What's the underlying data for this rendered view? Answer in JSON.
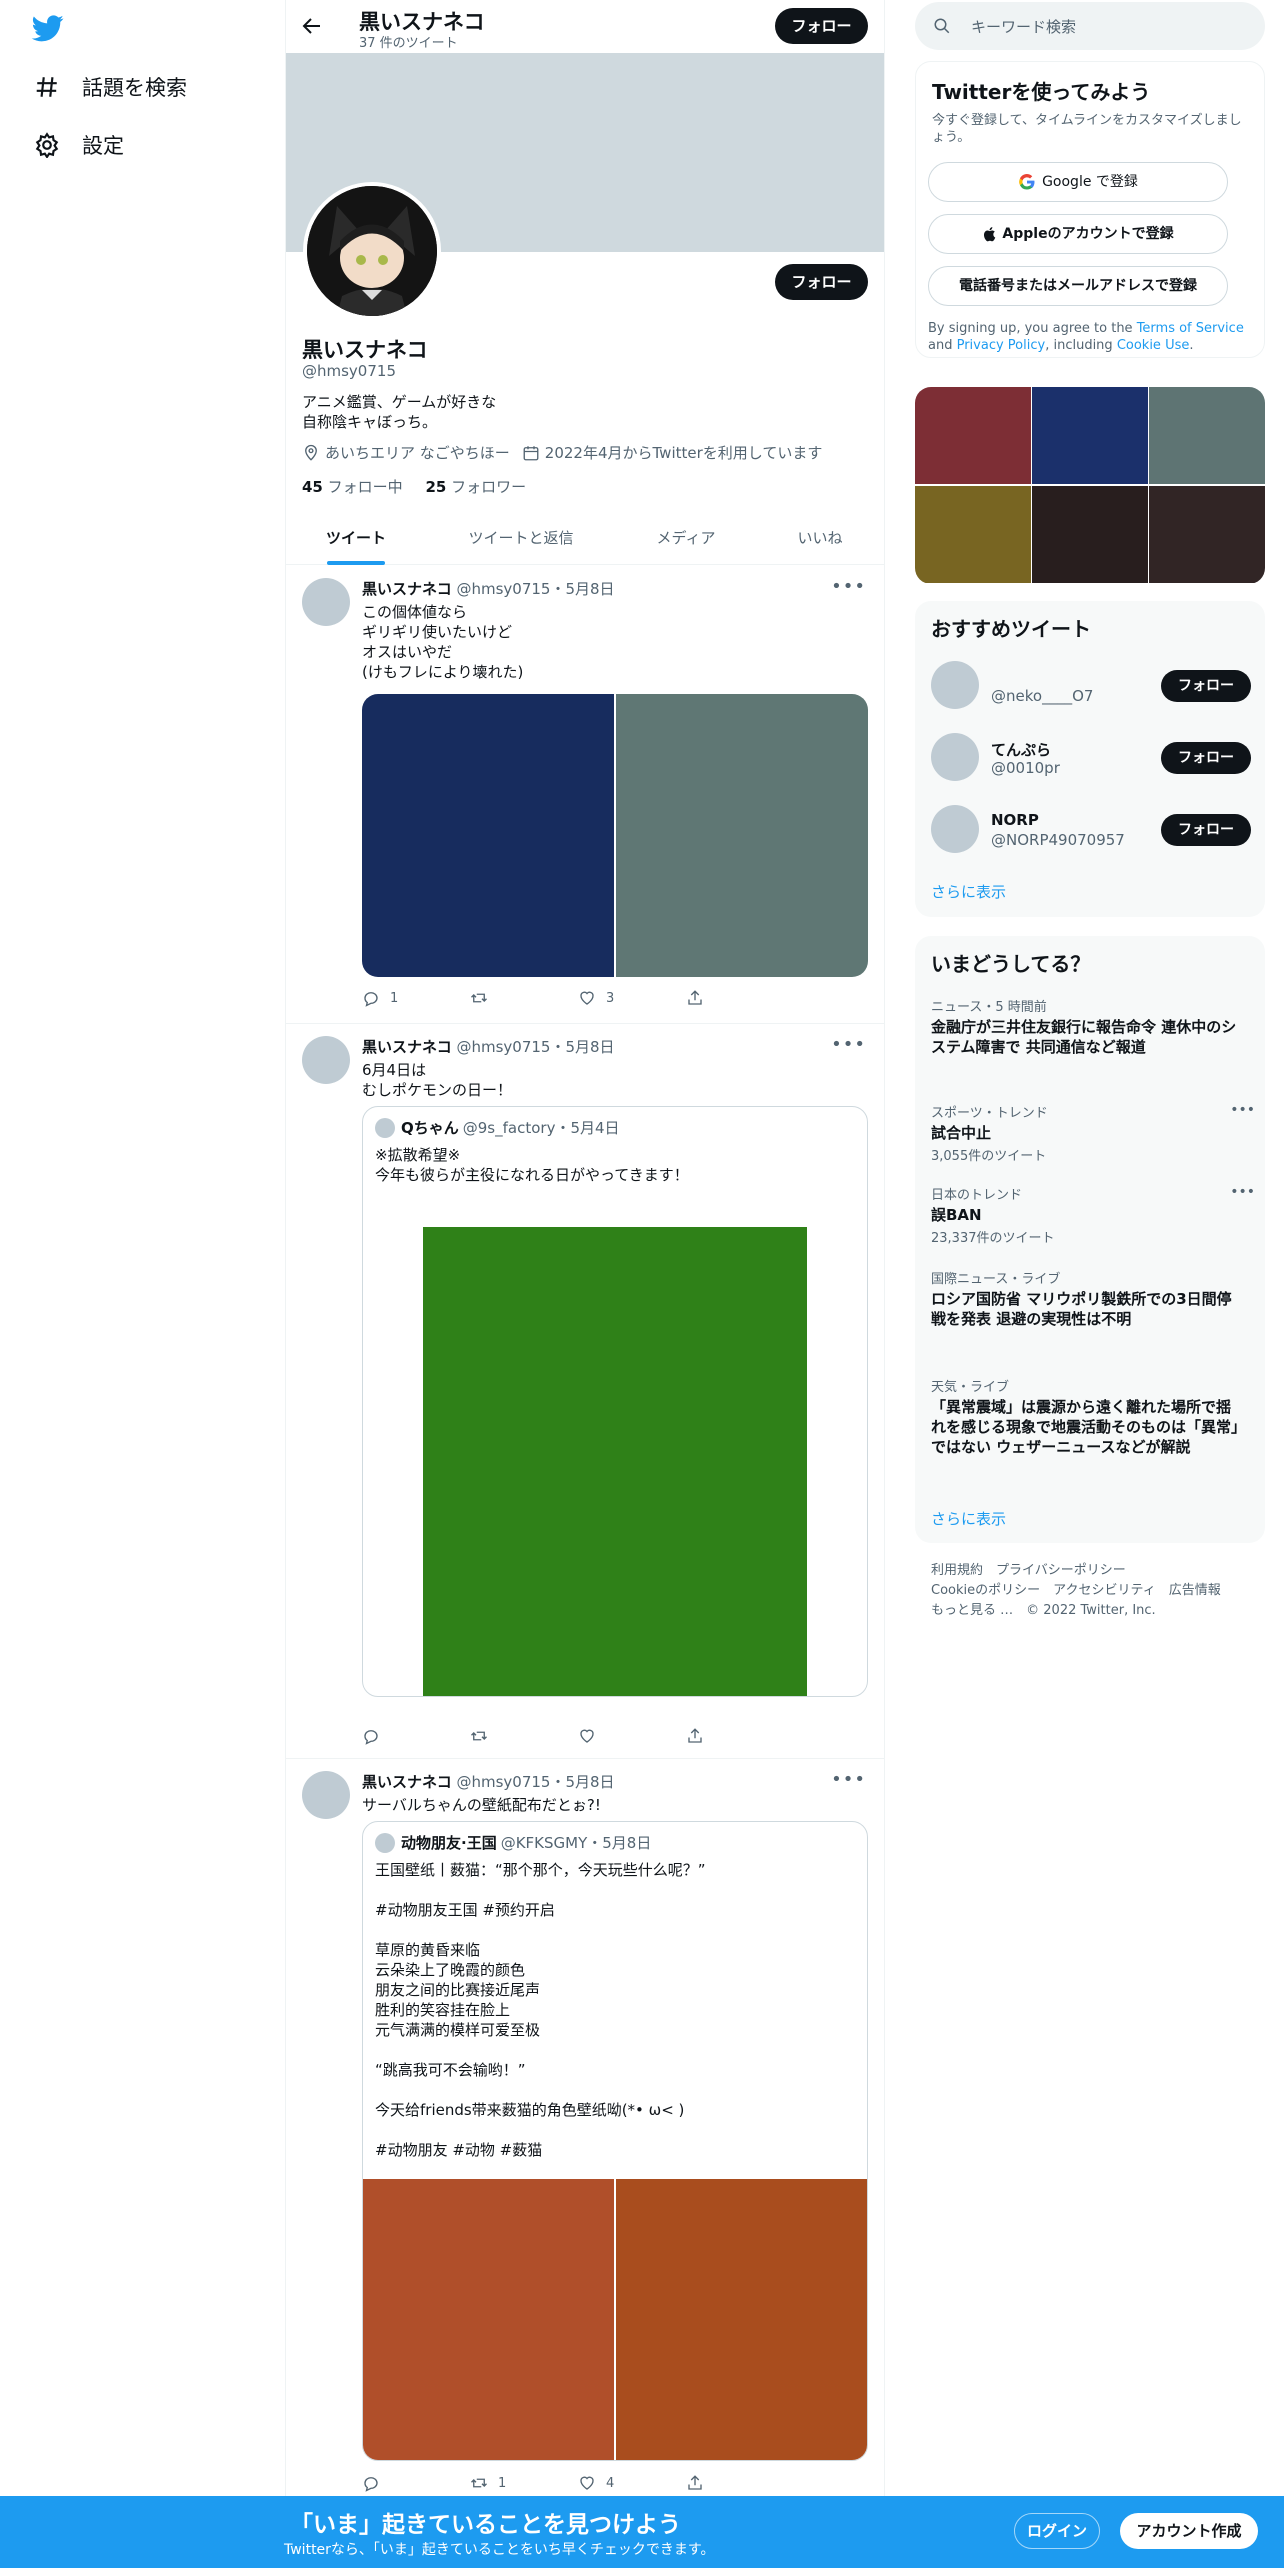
{
  "nav": {
    "explore_label": "話題を検索",
    "settings_label": "設定"
  },
  "header": {
    "name": "黒いスナネコ",
    "tweet_count": "37 件のツイート",
    "follow_label": "フォロー"
  },
  "profile": {
    "follow_label": "フォロー",
    "name": "黒いスナネコ",
    "handle": "@hmsy0715",
    "bio_line1": "アニメ鑑賞、ゲームが好きな",
    "bio_line2": "自称陰キャぼっち。",
    "location": "あいちエリア なごやちほー",
    "joined": "2022年4月からTwitterを利用しています",
    "following_count": "45",
    "following_label": "フォロー中",
    "followers_count": "25",
    "followers_label": "フォロワー"
  },
  "tabs": [
    "ツイート",
    "ツイートと返信",
    "メディア",
    "いいね"
  ],
  "tweets": [
    {
      "name": "黒いスナネコ",
      "meta": "@hmsy0715・5月8日",
      "text": "この個体値なら\nギリギリ使いたいけど\nオスはいやだ\n(けもフレにより壊れた)",
      "replies": "1",
      "retweets": "",
      "likes": "3",
      "media_colors": [
        "#172c5e",
        "#5f7774"
      ]
    },
    {
      "name": "黒いスナネコ",
      "meta": "@hmsy0715・5月8日",
      "text": "6月4日は\nむしポケモンの日ー！",
      "replies": "",
      "retweets": "",
      "likes": "",
      "quote": {
        "name": "Qちゃん",
        "meta": "@9s_factory・5月4日",
        "text": "※拡散希望※\n今年も彼らが主役になれる日がやってきます！",
        "media_color": "#2f8118"
      }
    },
    {
      "name": "黒いスナネコ",
      "meta": "@hmsy0715・5月8日",
      "text": "サーバルちゃんの壁紙配布だとぉ?!",
      "replies": "",
      "retweets": "1",
      "likes": "4",
      "quote": {
        "name": "动物朋友·王国",
        "meta": "@KFKSGMY・5月8日",
        "text": "王国壁纸丨薮猫：“那个那个，今天玩些什么呢？”\n\n#动物朋友王国 #预约开启\n\n草原的黄昏来临\n云朵染上了晚霞的颜色\n朋友之间的比赛接近尾声\n胜利的笑容挂在脸上\n元气满满的模样可爱至极\n\n“跳高我可不会输哟！”\n\n今天给friends带来薮猫的角色壁纸呦(*• ω< )\n\n#动物朋友 #动物 #薮猫",
        "media_colors": [
          "#b04f2a",
          "#a94d1e"
        ]
      }
    }
  ],
  "right": {
    "search_placeholder": "キーワード検索",
    "signup_title": "Twitterを使ってみよう",
    "signup_sub": "今すぐ登録して、タイムラインをカスタマイズしましょう。",
    "google_label": "Google で登録",
    "apple_label": "Appleのアカウントで登録",
    "phone_label": "電話番号またはメールアドレスで登録",
    "legal_a": "By signing up, you agree to the ",
    "legal_tos": "Terms of Service",
    "legal_b": " and ",
    "legal_privacy": "Privacy Policy",
    "legal_c": ", including ",
    "legal_cookie": "Cookie Use",
    "legal_d": ".",
    "media_grid_colors": [
      "#7d2e35",
      "#1b306b",
      "#5e7473",
      "#786522",
      "#281e1e",
      "#312525"
    ],
    "rec_title": "おすすめツイート",
    "recs": [
      {
        "name": "",
        "handle": "@neko____O7",
        "button": "フォロー"
      },
      {
        "name": "てんぷら",
        "handle": "@0010pr",
        "button": "フォロー"
      },
      {
        "name": "NORP",
        "handle": "@NORP49070957",
        "button": "フォロー"
      }
    ],
    "rec_more": "さらに表示",
    "trends_title": "いまどうしてる？",
    "trends": [
      {
        "context": "ニュース・5 時間前",
        "title": "金融庁が三井住友銀行に報告命令 連休中のシステム障害で 共同通信など報道",
        "count": ""
      },
      {
        "context": "スポーツ・トレンド",
        "title": "試合中止",
        "count": "3,055件のツイート"
      },
      {
        "context": "日本のトレンド",
        "title": "誤BAN",
        "count": "23,337件のツイート"
      },
      {
        "context": "国際ニュース・ライブ",
        "title": "ロシア国防省 マリウポリ製鉄所での3日間停戦を発表 退避の実現性は不明",
        "count": ""
      },
      {
        "context": "天気・ライブ",
        "title": "「異常震域」は震源から遠く離れた場所で揺れを感じる現象で地震活動そのものは「異常」ではない ウェザーニュースなどが解説",
        "count": ""
      }
    ],
    "trends_more": "さらに表示",
    "footer_links": [
      "利用規約",
      "プライバシーポリシー",
      "Cookieのポリシー",
      "アクセシビリティ",
      "広告情報",
      "もっと見る …",
      "© 2022 Twitter, Inc."
    ]
  },
  "bottom_bar": {
    "title": "「いま」起きていることを見つけよう",
    "subtitle": "Twitterなら、「いま」起きていることをいち早くチェックできます。",
    "login_label": "ログイン",
    "signup_label": "アカウント作成"
  }
}
